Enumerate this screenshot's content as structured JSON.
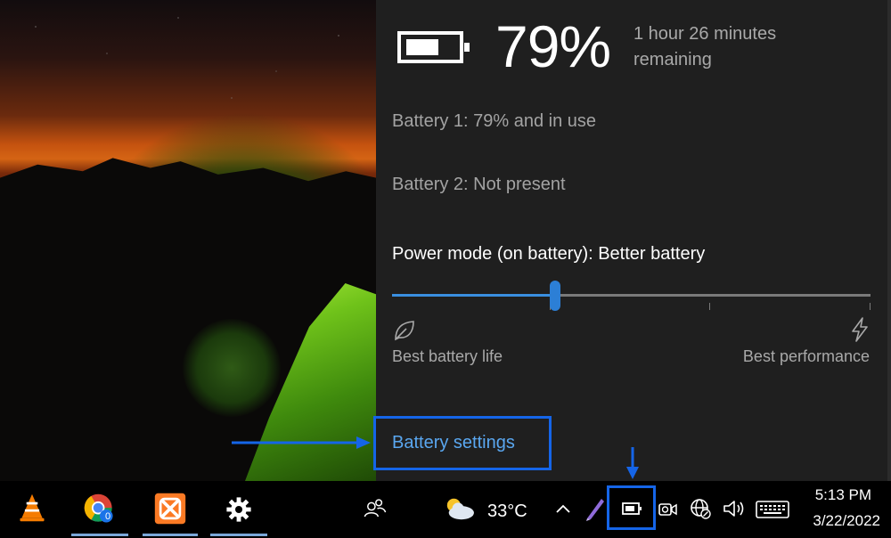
{
  "flyout": {
    "battery_level": 0.79,
    "percent_text": "79%",
    "remaining_text": "1 hour 26 minutes remaining",
    "battery1": "Battery 1: 79% and in use",
    "battery2": "Battery 2: Not present",
    "power_mode_text": "Power mode (on battery): Better battery",
    "slider_value": 0.34,
    "label_left": "Best battery life",
    "label_right": "Best performance",
    "settings_link": "Battery settings",
    "icons": {
      "battery": "battery-icon",
      "leaf": "leaf-icon",
      "bolt": "bolt-icon"
    }
  },
  "taskbar": {
    "apps": [
      {
        "name": "vlc-icon"
      },
      {
        "name": "chrome-icon",
        "badge": "0"
      },
      {
        "name": "xampp-icon"
      },
      {
        "name": "settings-gear-icon"
      }
    ],
    "weather_temp": "33°C",
    "time": "5:13 PM",
    "date": "3/22/2022"
  },
  "colors": {
    "accent": "#2c7fd6",
    "link": "#5aa7f0",
    "annotation": "#1565e8",
    "flyout_bg": "#1f1f1f"
  }
}
